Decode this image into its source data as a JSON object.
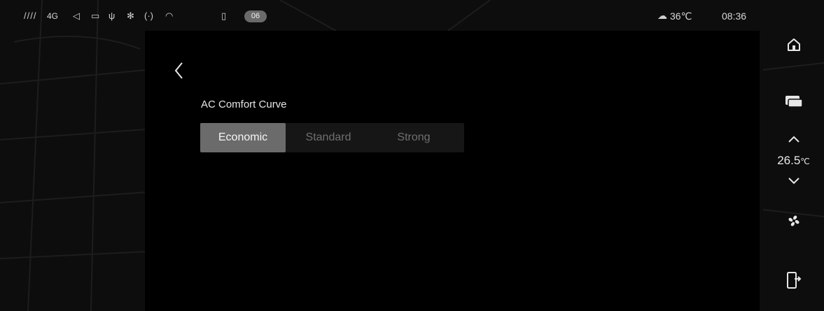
{
  "status_bar": {
    "signal_text": "4G",
    "badge": "06",
    "weather_temp": "36℃",
    "time": "08:36"
  },
  "settings": {
    "title": "AC Comfort Curve",
    "options": [
      "Economic",
      "Standard",
      "Strong"
    ],
    "selected": "Economic"
  },
  "dock": {
    "temperature_value": "26.5",
    "temperature_unit": "℃"
  },
  "colors": {
    "selected_bg": "#6b6b6b",
    "segment_bg": "#161616",
    "panel_bg": "#000000"
  }
}
